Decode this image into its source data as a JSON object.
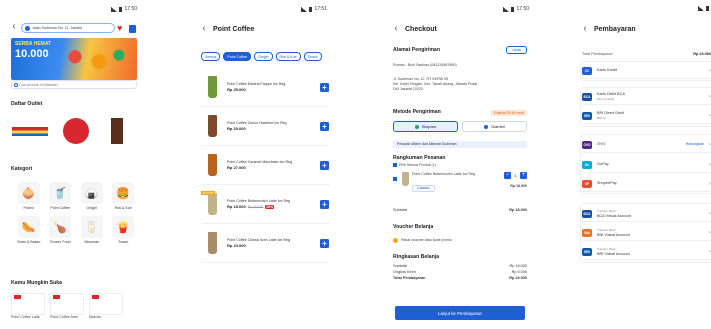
{
  "status": {
    "time": "17.50",
    "time2": "17:51"
  },
  "home": {
    "address": "Jalan Sudirman No. 12, Jakarta",
    "banner": {
      "line1": "SERBA HEMAT",
      "line2": "10.000"
    },
    "search_placeholder": "Cari produk di Alfamart",
    "outlets_title": "Daftar Outlet",
    "outlets": [
      "Alfamart",
      "Point Coffee",
      "Lawson"
    ],
    "categories_title": "Kategori",
    "categories": [
      {
        "label": "Promo",
        "icon": "🧅"
      },
      {
        "label": "Point Coffee",
        "icon": "🥤"
      },
      {
        "label": "Onigiri",
        "icon": "🍙"
      },
      {
        "label": "Roti & Kue",
        "icon": "🍔"
      },
      {
        "label": "Sosis & Bakso",
        "icon": "🌭"
      },
      {
        "label": "Frozen Food",
        "icon": "🍗"
      },
      {
        "label": "Minuman",
        "icon": "🥛"
      },
      {
        "label": "Snack",
        "icon": "🍟"
      }
    ],
    "popular_title": "Kamu Mungkin Suka",
    "popular": [
      "Point Coffee Latte",
      "Point Coffee Aren",
      "Matcha"
    ]
  },
  "coffee": {
    "title": "Point Coffee",
    "chips": [
      "Semua",
      "Point Coffee",
      "Onigiri",
      "Roti & Kue",
      "Snack"
    ],
    "items": [
      {
        "name": "Point Coffee Matcha Frappe Ice Reg",
        "price": "Rp 25.000",
        "color": "#6f9a3b"
      },
      {
        "name": "Point Coffee Choco Hazelnut Ice Reg",
        "price": "Rp 25.000",
        "color": "#7a4a2b"
      },
      {
        "name": "Point Coffee Caramel Macchiato Ice Reg",
        "price": "Rp 27.000",
        "color": "#b5641f"
      },
      {
        "name": "Point Coffee Butterscotch Latte Ice Reg",
        "price": "Rp 18.000",
        "old": "Rp 25.000",
        "disc": "28%",
        "tag": "PROMO",
        "color": "#c2b48a"
      },
      {
        "name": "Point Coffee Classic Aren Latte Ice Reg",
        "price": "Rp 23.000",
        "color": "#a98d6a"
      }
    ]
  },
  "checkout": {
    "title": "Checkout",
    "addr_title": "Alamat Pengiriman",
    "change": "Ubah",
    "addr_name": "Rumah - Budi Santoso (081234567890)",
    "addr_lines": [
      "Jl. Sudirman No. 12, RT 03/RW 05",
      "Kel. Karet Tengsin, Kec. Tanah Abang, Jakarta Pusat",
      "DKI Jakarta 10220"
    ],
    "method_title": "Metode Pengiriman",
    "method_warn": "Estimasi 30-60 menit",
    "methods": [
      "Ekspres",
      "Diambil"
    ],
    "info": "Pesanan dikirim dari Alfamart Sudirman",
    "order_title": "Rangkuman Pesanan",
    "select_all": "Pilih Semua Produk (1)",
    "item_name": "Point Coffee Butterscotch Latte Ice Reg",
    "item_note": "Catatan",
    "item_qty": "1",
    "item_price": "Rp 18.000",
    "subtotal_label": "Subtotal",
    "subtotal": "Rp 18.000",
    "voucher_title": "Voucher Belanja",
    "voucher_text": "Pakai voucher atau kode promo",
    "summary_title": "Ringkasan Belanja",
    "rows": [
      {
        "k": "Subtotal",
        "v": "Rp 18.000"
      },
      {
        "k": "Ongkos Kirim",
        "v": "Rp 5.000"
      },
      {
        "k": "Total Pembayaran",
        "v": "Rp 23.000"
      }
    ],
    "pay_button": "Lanjut ke Pembayaran"
  },
  "payment": {
    "title": "Pembayaran",
    "header_left": "Total Pembayaran",
    "header_right": "Rp 23.000",
    "methods": [
      {
        "name": "Kartu Kredit",
        "sub": "",
        "color": "#1e5fd6",
        "abbr": "CC"
      },
      {
        "name": "Kartu Debit BCA",
        "sub": "BCA OneKlik",
        "color": "#1a4fa0",
        "abbr": "BCA"
      },
      {
        "name": "BRI Direct Debit",
        "sub": "BRImo",
        "color": "#0f5ba8",
        "abbr": "BRI"
      },
      {
        "name": "OVO",
        "sub": "Hubungkan",
        "color": "#4c2a86",
        "abbr": "OVO"
      },
      {
        "name": "GoPay",
        "sub": "",
        "color": "#00aed6",
        "abbr": "Go"
      },
      {
        "name": "ShopeePay",
        "sub": "",
        "color": "#ee4d2d",
        "abbr": "SP"
      },
      {
        "name": "BCA Virtual Account",
        "sub": "Transfer Bank",
        "color": "#1a4fa0",
        "abbr": "BCA"
      },
      {
        "name": "BNI Virtual Account",
        "sub": "Transfer Bank",
        "color": "#f37021",
        "abbr": "BNI"
      },
      {
        "name": "BRI Virtual Account",
        "sub": "Transfer Bank",
        "color": "#0f5ba8",
        "abbr": "BRI"
      }
    ],
    "link_label": "Hubungkan"
  }
}
